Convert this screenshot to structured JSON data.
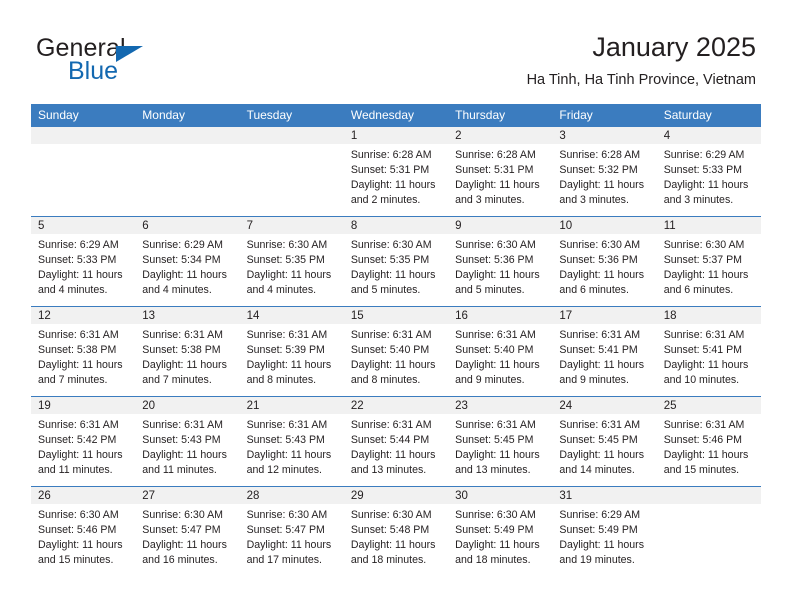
{
  "brand": {
    "word1": "General",
    "word2": "Blue",
    "triangle_color": "#1368b0",
    "icon": "triangle-icon"
  },
  "header": {
    "title": "January 2025",
    "subtitle": "Ha Tinh, Ha Tinh Province, Vietnam"
  },
  "colors": {
    "header_blue": "#3b7cbf",
    "daynum_strip": "#f1f1f1",
    "text": "#231f20",
    "brand_blue": "#1368b0"
  },
  "calendar": {
    "weekday_headers": [
      "Sunday",
      "Monday",
      "Tuesday",
      "Wednesday",
      "Thursday",
      "Friday",
      "Saturday"
    ],
    "weeks": [
      [
        {
          "empty": true
        },
        {
          "empty": true
        },
        {
          "empty": true
        },
        {
          "day": "1",
          "sunrise": "Sunrise: 6:28 AM",
          "sunset": "Sunset: 5:31 PM",
          "daylight1": "Daylight: 11 hours",
          "daylight2": "and 2 minutes."
        },
        {
          "day": "2",
          "sunrise": "Sunrise: 6:28 AM",
          "sunset": "Sunset: 5:31 PM",
          "daylight1": "Daylight: 11 hours",
          "daylight2": "and 3 minutes."
        },
        {
          "day": "3",
          "sunrise": "Sunrise: 6:28 AM",
          "sunset": "Sunset: 5:32 PM",
          "daylight1": "Daylight: 11 hours",
          "daylight2": "and 3 minutes."
        },
        {
          "day": "4",
          "sunrise": "Sunrise: 6:29 AM",
          "sunset": "Sunset: 5:33 PM",
          "daylight1": "Daylight: 11 hours",
          "daylight2": "and 3 minutes."
        }
      ],
      [
        {
          "day": "5",
          "sunrise": "Sunrise: 6:29 AM",
          "sunset": "Sunset: 5:33 PM",
          "daylight1": "Daylight: 11 hours",
          "daylight2": "and 4 minutes."
        },
        {
          "day": "6",
          "sunrise": "Sunrise: 6:29 AM",
          "sunset": "Sunset: 5:34 PM",
          "daylight1": "Daylight: 11 hours",
          "daylight2": "and 4 minutes."
        },
        {
          "day": "7",
          "sunrise": "Sunrise: 6:30 AM",
          "sunset": "Sunset: 5:35 PM",
          "daylight1": "Daylight: 11 hours",
          "daylight2": "and 4 minutes."
        },
        {
          "day": "8",
          "sunrise": "Sunrise: 6:30 AM",
          "sunset": "Sunset: 5:35 PM",
          "daylight1": "Daylight: 11 hours",
          "daylight2": "and 5 minutes."
        },
        {
          "day": "9",
          "sunrise": "Sunrise: 6:30 AM",
          "sunset": "Sunset: 5:36 PM",
          "daylight1": "Daylight: 11 hours",
          "daylight2": "and 5 minutes."
        },
        {
          "day": "10",
          "sunrise": "Sunrise: 6:30 AM",
          "sunset": "Sunset: 5:36 PM",
          "daylight1": "Daylight: 11 hours",
          "daylight2": "and 6 minutes."
        },
        {
          "day": "11",
          "sunrise": "Sunrise: 6:30 AM",
          "sunset": "Sunset: 5:37 PM",
          "daylight1": "Daylight: 11 hours",
          "daylight2": "and 6 minutes."
        }
      ],
      [
        {
          "day": "12",
          "sunrise": "Sunrise: 6:31 AM",
          "sunset": "Sunset: 5:38 PM",
          "daylight1": "Daylight: 11 hours",
          "daylight2": "and 7 minutes."
        },
        {
          "day": "13",
          "sunrise": "Sunrise: 6:31 AM",
          "sunset": "Sunset: 5:38 PM",
          "daylight1": "Daylight: 11 hours",
          "daylight2": "and 7 minutes."
        },
        {
          "day": "14",
          "sunrise": "Sunrise: 6:31 AM",
          "sunset": "Sunset: 5:39 PM",
          "daylight1": "Daylight: 11 hours",
          "daylight2": "and 8 minutes."
        },
        {
          "day": "15",
          "sunrise": "Sunrise: 6:31 AM",
          "sunset": "Sunset: 5:40 PM",
          "daylight1": "Daylight: 11 hours",
          "daylight2": "and 8 minutes."
        },
        {
          "day": "16",
          "sunrise": "Sunrise: 6:31 AM",
          "sunset": "Sunset: 5:40 PM",
          "daylight1": "Daylight: 11 hours",
          "daylight2": "and 9 minutes."
        },
        {
          "day": "17",
          "sunrise": "Sunrise: 6:31 AM",
          "sunset": "Sunset: 5:41 PM",
          "daylight1": "Daylight: 11 hours",
          "daylight2": "and 9 minutes."
        },
        {
          "day": "18",
          "sunrise": "Sunrise: 6:31 AM",
          "sunset": "Sunset: 5:41 PM",
          "daylight1": "Daylight: 11 hours",
          "daylight2": "and 10 minutes."
        }
      ],
      [
        {
          "day": "19",
          "sunrise": "Sunrise: 6:31 AM",
          "sunset": "Sunset: 5:42 PM",
          "daylight1": "Daylight: 11 hours",
          "daylight2": "and 11 minutes."
        },
        {
          "day": "20",
          "sunrise": "Sunrise: 6:31 AM",
          "sunset": "Sunset: 5:43 PM",
          "daylight1": "Daylight: 11 hours",
          "daylight2": "and 11 minutes."
        },
        {
          "day": "21",
          "sunrise": "Sunrise: 6:31 AM",
          "sunset": "Sunset: 5:43 PM",
          "daylight1": "Daylight: 11 hours",
          "daylight2": "and 12 minutes."
        },
        {
          "day": "22",
          "sunrise": "Sunrise: 6:31 AM",
          "sunset": "Sunset: 5:44 PM",
          "daylight1": "Daylight: 11 hours",
          "daylight2": "and 13 minutes."
        },
        {
          "day": "23",
          "sunrise": "Sunrise: 6:31 AM",
          "sunset": "Sunset: 5:45 PM",
          "daylight1": "Daylight: 11 hours",
          "daylight2": "and 13 minutes."
        },
        {
          "day": "24",
          "sunrise": "Sunrise: 6:31 AM",
          "sunset": "Sunset: 5:45 PM",
          "daylight1": "Daylight: 11 hours",
          "daylight2": "and 14 minutes."
        },
        {
          "day": "25",
          "sunrise": "Sunrise: 6:31 AM",
          "sunset": "Sunset: 5:46 PM",
          "daylight1": "Daylight: 11 hours",
          "daylight2": "and 15 minutes."
        }
      ],
      [
        {
          "day": "26",
          "sunrise": "Sunrise: 6:30 AM",
          "sunset": "Sunset: 5:46 PM",
          "daylight1": "Daylight: 11 hours",
          "daylight2": "and 15 minutes."
        },
        {
          "day": "27",
          "sunrise": "Sunrise: 6:30 AM",
          "sunset": "Sunset: 5:47 PM",
          "daylight1": "Daylight: 11 hours",
          "daylight2": "and 16 minutes."
        },
        {
          "day": "28",
          "sunrise": "Sunrise: 6:30 AM",
          "sunset": "Sunset: 5:47 PM",
          "daylight1": "Daylight: 11 hours",
          "daylight2": "and 17 minutes."
        },
        {
          "day": "29",
          "sunrise": "Sunrise: 6:30 AM",
          "sunset": "Sunset: 5:48 PM",
          "daylight1": "Daylight: 11 hours",
          "daylight2": "and 18 minutes."
        },
        {
          "day": "30",
          "sunrise": "Sunrise: 6:30 AM",
          "sunset": "Sunset: 5:49 PM",
          "daylight1": "Daylight: 11 hours",
          "daylight2": "and 18 minutes."
        },
        {
          "day": "31",
          "sunrise": "Sunrise: 6:29 AM",
          "sunset": "Sunset: 5:49 PM",
          "daylight1": "Daylight: 11 hours",
          "daylight2": "and 19 minutes."
        },
        {
          "empty": true
        }
      ]
    ]
  }
}
